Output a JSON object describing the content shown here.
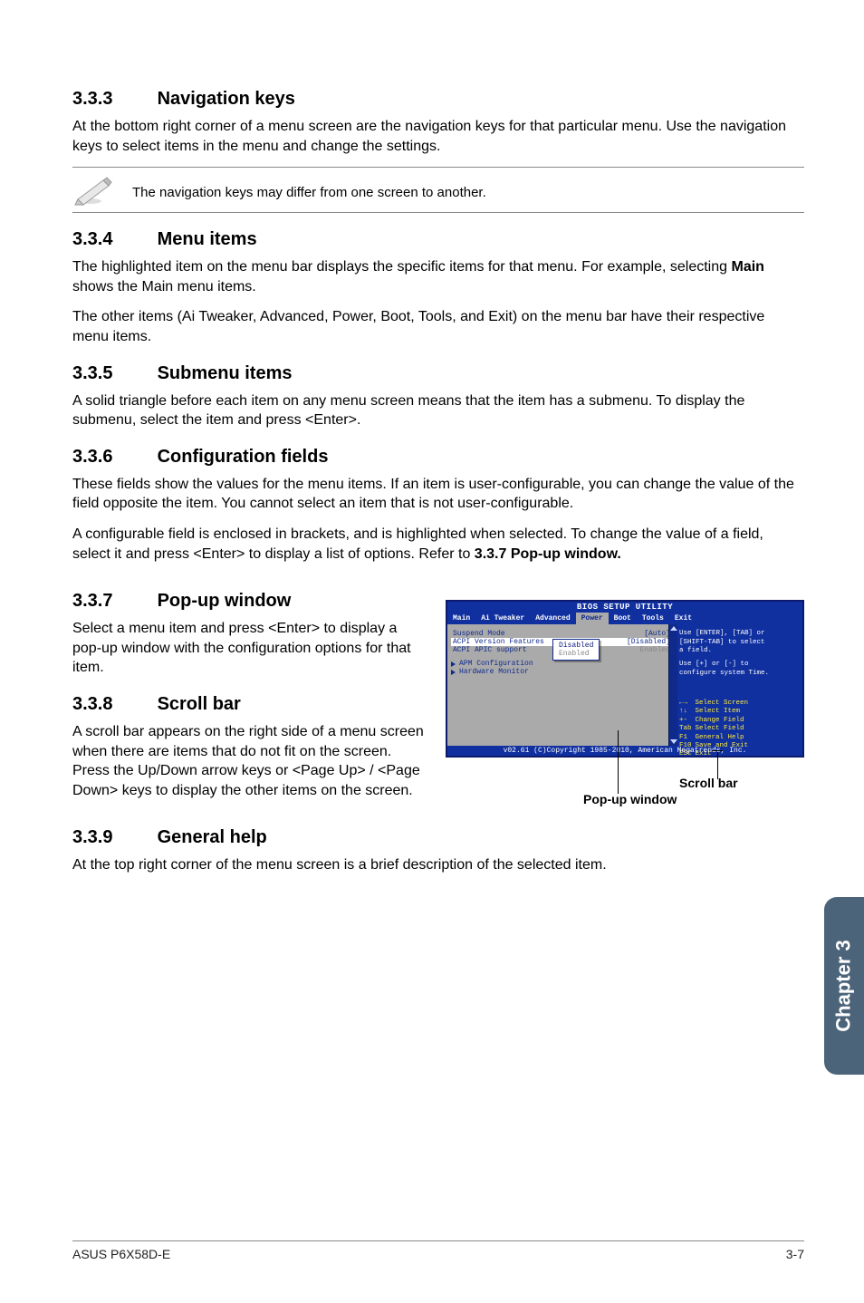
{
  "sections": {
    "s333": {
      "num": "3.3.3",
      "title": "Navigation keys",
      "p1": "At the bottom right corner of a menu screen are the navigation keys for that particular menu. Use the navigation keys to select items in the menu and change the settings.",
      "note": "The navigation keys may differ from one screen to another."
    },
    "s334": {
      "num": "3.3.4",
      "title": "Menu items",
      "p1a": "The highlighted item on the menu bar displays the specific items for that menu. For example, selecting ",
      "p1b": "Main",
      "p1c": " shows the Main menu items.",
      "p2": "The other items (Ai Tweaker, Advanced, Power, Boot, Tools, and Exit) on the menu bar have their respective menu items."
    },
    "s335": {
      "num": "3.3.5",
      "title": "Submenu items",
      "p1": "A solid triangle before each item on any menu screen means that the item has a submenu. To display the submenu, select the item and press <Enter>."
    },
    "s336": {
      "num": "3.3.6",
      "title": "Configuration fields",
      "p1": "These fields show the values for the menu items. If an item is user-configurable, you can change the value of the field opposite the item. You cannot select an item that is not user-configurable.",
      "p2a": "A configurable field is enclosed in brackets, and is highlighted when selected. To change the value of a field, select it and press <Enter> to display a list of options. Refer to ",
      "p2b": "3.3.7 Pop-up window."
    },
    "s337": {
      "num": "3.3.7",
      "title": "Pop-up window",
      "p1": "Select a menu item and press <Enter> to display a pop-up window with the configuration options for that item."
    },
    "s338": {
      "num": "3.3.8",
      "title": "Scroll bar",
      "p1": "A scroll bar appears on the right side of a menu screen when there are items that do not fit on the screen. Press the Up/Down arrow keys or <Page Up> / <Page Down> keys to display the other items on the screen."
    },
    "s339": {
      "num": "3.3.9",
      "title": "General help",
      "p1": "At the top right corner of the menu screen is a brief description of the selected item."
    }
  },
  "sidetab": "Chapter 3",
  "footer": {
    "left": "ASUS P6X58D-E",
    "right": "3-7"
  },
  "bios": {
    "title": "BIOS SETUP UTILITY",
    "tabs": [
      "Main",
      "Ai Tweaker",
      "Advanced",
      "Power",
      "Boot",
      "Tools",
      "Exit"
    ],
    "selected_tab": "Power",
    "rows": [
      {
        "label": "Suspend Mode",
        "value": "[Auto]"
      },
      {
        "label": "ACPI Version Features",
        "value": "[Disabled]"
      },
      {
        "label": "ACPI APIC support",
        "value": "Enabled"
      }
    ],
    "popup": [
      "Disabled",
      "Enabled"
    ],
    "sub": [
      "APM Configuration",
      "Hardware Monitor"
    ],
    "help": {
      "line1": "Use [ENTER], [TAB] or",
      "line2": "[SHIFT-TAB] to select",
      "line3": "a field.",
      "line4": "Use [+] or [-] to",
      "line5": "configure system Time."
    },
    "keys": [
      {
        "k": "←→",
        "d": "Select Screen"
      },
      {
        "k": "↑↓",
        "d": "Select Item"
      },
      {
        "k": "+-",
        "d": "Change Field"
      },
      {
        "k": "Tab",
        "d": "Select Field"
      },
      {
        "k": "F1",
        "d": "General Help"
      },
      {
        "k": "F10",
        "d": "Save and Exit"
      },
      {
        "k": "ESC",
        "d": "Exit"
      }
    ],
    "copyright": "v02.61 (C)Copyright 1985-2010, American Megatrends, Inc."
  },
  "fig_labels": {
    "scroll": "Scroll bar",
    "popup": "Pop-up window"
  }
}
